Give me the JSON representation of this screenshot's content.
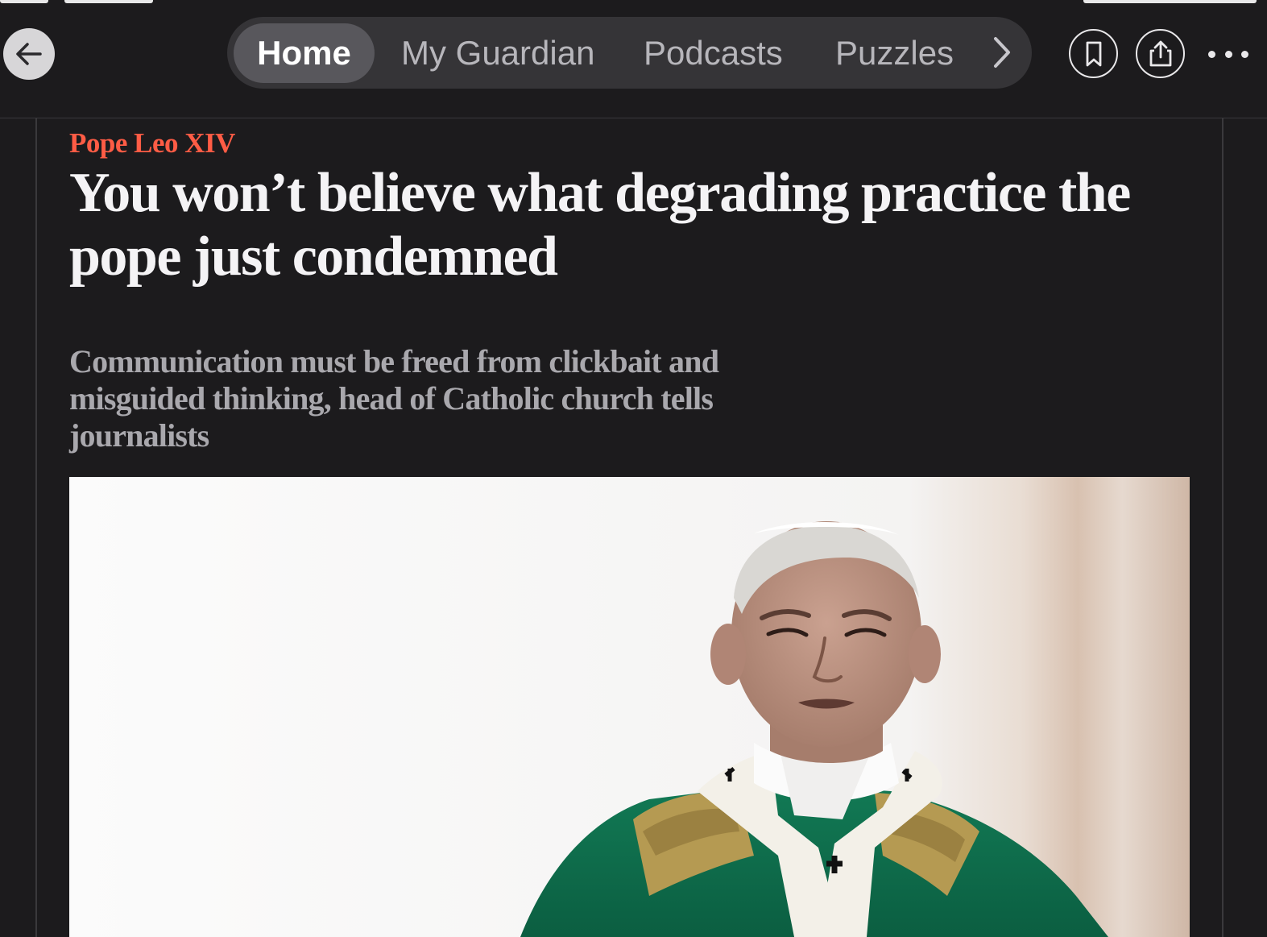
{
  "nav": {
    "back_icon": "arrow-left-icon",
    "tabs": [
      {
        "label": "Home",
        "active": true
      },
      {
        "label": "My Guardian",
        "active": false
      },
      {
        "label": "Podcasts",
        "active": false
      },
      {
        "label": "Puzzles",
        "active": false
      }
    ],
    "more_tabs_icon": "chevron-right-icon",
    "bookmark_icon": "bookmark-icon",
    "share_icon": "share-icon",
    "more_icon": "ellipsis-icon"
  },
  "article": {
    "kicker": "Pope Leo XIV",
    "headline": "You won’t believe what degrading practice the pope just condemned",
    "standfirst": "Communication must be freed from clickbait and misguided thinking, head of Catholic church tells journalists",
    "photo": {
      "alt": "Pope Leo XIV in green and gold vestments",
      "icon": "photo"
    }
  },
  "colors": {
    "background": "#1c1b1d",
    "kicker": "#ff5c45",
    "headline": "#f4f3f5",
    "standfirst": "#a9a8ad",
    "tabbar": "#353437",
    "tab_active": "#58575c"
  }
}
